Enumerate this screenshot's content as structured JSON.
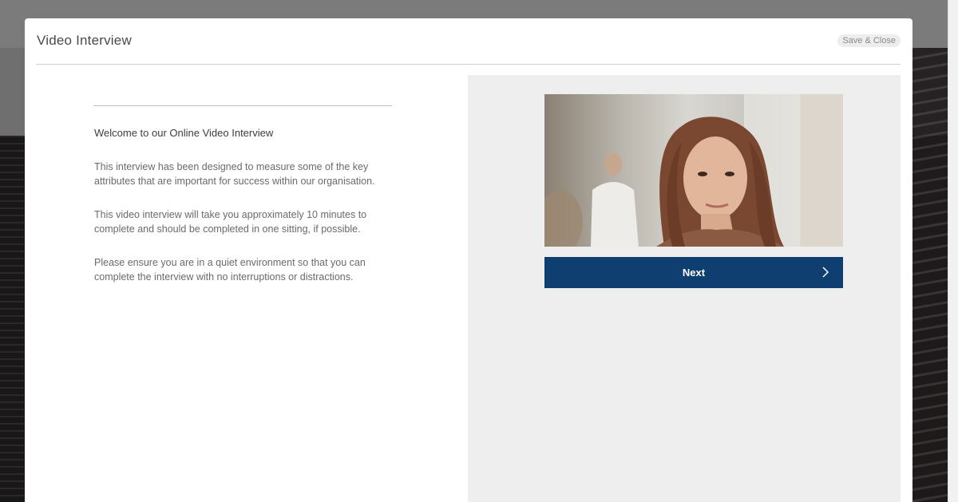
{
  "modal": {
    "title": "Video Interview",
    "close_label": "Save & Close"
  },
  "intro": {
    "heading": "Welcome to our Online Video Interview",
    "paragraphs": [
      "This interview has been designed to measure some of the key attributes that are important for success within our organisation.",
      "This video interview will take you approximately 10 minutes to complete and should be completed in one sitting, if possible.",
      "Please ensure you are in a quiet environment so that you can complete the interview with no interruptions or distractions."
    ]
  },
  "panel": {
    "next_label": "Next",
    "next_icon": "chevron-right-icon",
    "photo": "candidate-portrait-image"
  },
  "colors": {
    "accent": "#0f3f70",
    "panel_bg": "#eeeeee"
  }
}
